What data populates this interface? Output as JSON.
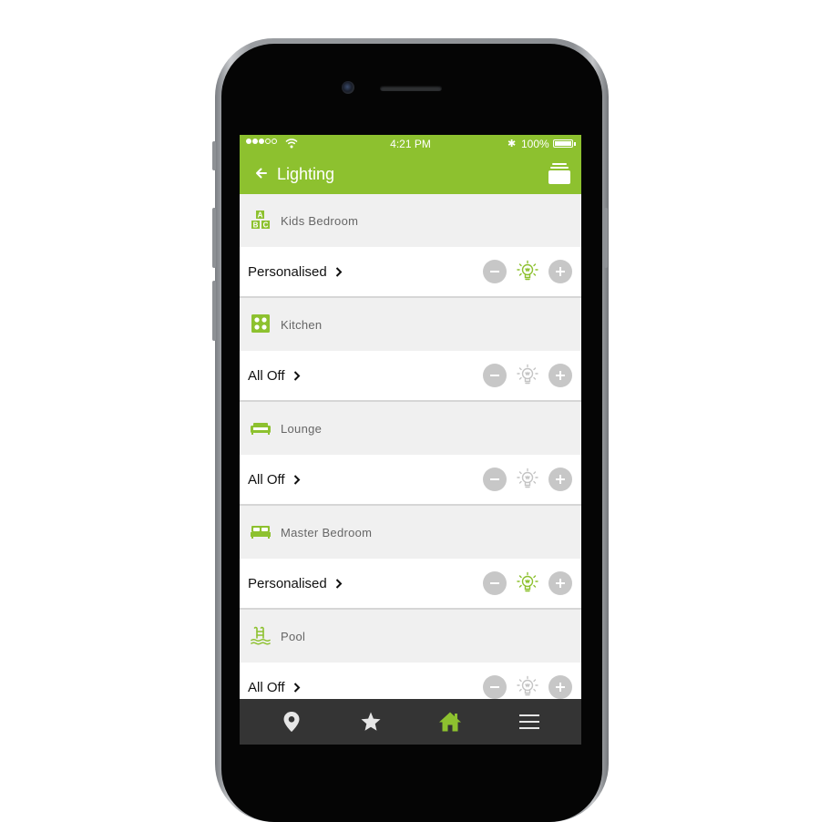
{
  "status_bar": {
    "time": "4:21 PM",
    "battery_text": "100%",
    "battery_level": 1.0,
    "signal_bars": 3,
    "signal_total": 5
  },
  "header": {
    "title": "Lighting",
    "back_icon": "back-arrow-icon",
    "action_icon": "layers-icon"
  },
  "rooms": [
    {
      "name": "Kids Bedroom",
      "icon": "abc-blocks-icon",
      "mode": "Personalised",
      "on": true
    },
    {
      "name": "Kitchen",
      "icon": "stove-icon",
      "mode": "All Off",
      "on": false
    },
    {
      "name": "Lounge",
      "icon": "sofa-icon",
      "mode": "All Off",
      "on": false
    },
    {
      "name": "Master Bedroom",
      "icon": "bed-icon",
      "mode": "Personalised",
      "on": true
    },
    {
      "name": "Pool",
      "icon": "pool-ladder-icon",
      "mode": "All Off",
      "on": false
    }
  ],
  "tab_bar": {
    "tabs": [
      "location-icon",
      "star-icon",
      "home-icon",
      "menu-icon"
    ],
    "active_index": 2
  },
  "colors": {
    "accent": "#8dc12f",
    "bulb_off": "#c4c4c4",
    "button_grey": "#c7c7c7",
    "tab_bar": "#343434",
    "tab_icon": "#e6e6e6"
  }
}
